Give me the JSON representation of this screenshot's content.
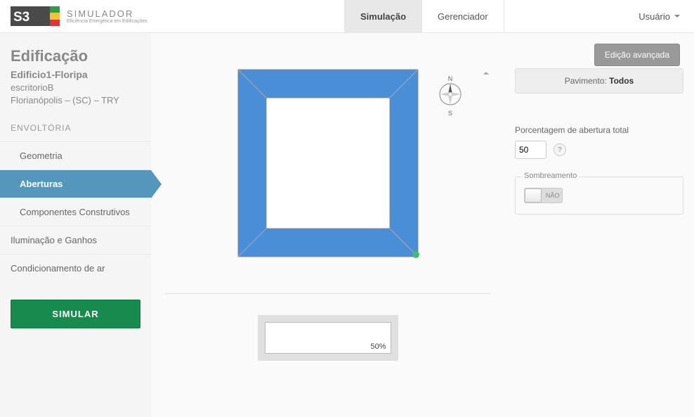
{
  "header": {
    "logo_title": "SIMULADOR",
    "logo_subtitle": "Eficiência Energética em Edificações",
    "user_label": "Usuário"
  },
  "tabs": {
    "simulacao": "Simulação",
    "gerenciador": "Gerenciador"
  },
  "sidebar": {
    "title": "Edificação",
    "building": "Edificio1-Floripa",
    "zone": "escritorioB",
    "location": "Florianópolis – (SC) – TRY",
    "section": "ENVOLTÓRIA",
    "items": {
      "geometria": "Geometria",
      "aberturas": "Aberturas",
      "componentes": "Componentes Construtivos",
      "iluminacao": "Iluminação e Ganhos",
      "condicionamento": "Condicionamento de ar"
    },
    "simular": "SIMULAR"
  },
  "canvas": {
    "advanced": "Edição avançada",
    "compass_n": "N",
    "compass_s": "S",
    "elev_pct": "50%"
  },
  "panel": {
    "pavimento_label": "Pavimento: ",
    "pavimento_value": "Todos",
    "abertura_label": "Porcentagem de abertura total",
    "abertura_value": "50",
    "sombreamento_label": "Sombreamento",
    "toggle_off": "NÃO"
  }
}
